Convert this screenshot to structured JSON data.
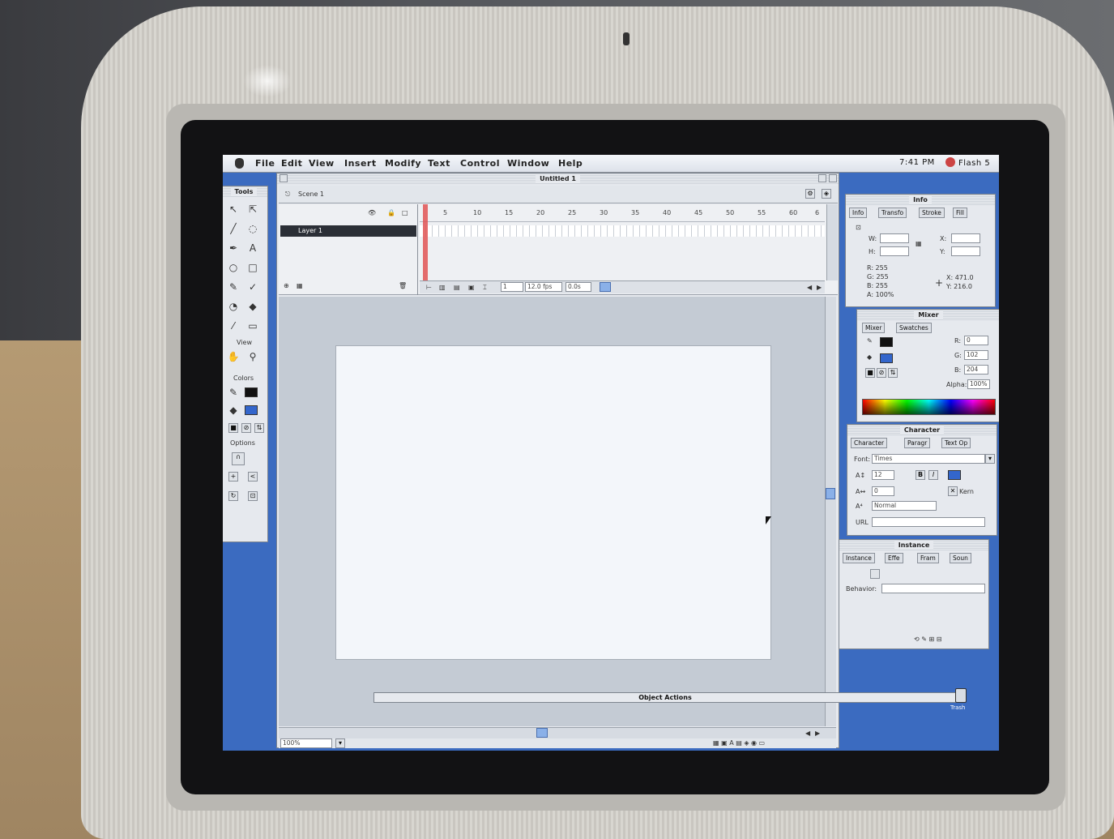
{
  "menubar": {
    "items": [
      "File",
      "Edit",
      "View",
      "Insert",
      "Modify",
      "Text",
      "Control",
      "Window",
      "Help"
    ],
    "clock": "7:41 PM",
    "app_name": "Flash 5"
  },
  "tools": {
    "title": "Tools",
    "view_label": "View",
    "colors_label": "Colors",
    "options_label": "Options",
    "items": [
      "arrow-icon",
      "subselect-icon",
      "line-icon",
      "lasso-icon",
      "pen-icon",
      "text-tool-icon",
      "oval-icon",
      "rectangle-icon",
      "pencil-icon",
      "brush-icon",
      "ink-bottle-icon",
      "paint-bucket-icon",
      "eyedropper-icon",
      "eraser-icon"
    ]
  },
  "document": {
    "title": "Untitled 1",
    "scene": "Scene 1",
    "layer": "Layer 1",
    "frame_numbers": [
      "5",
      "10",
      "15",
      "20",
      "25",
      "30",
      "35",
      "40",
      "45",
      "50",
      "55",
      "60",
      "6"
    ],
    "current_frame": "1",
    "fps": "12.0 fps",
    "elapsed": "0.0s",
    "zoom": "100%",
    "object_actions": "Object Actions"
  },
  "info_panel": {
    "title": "Info",
    "tabs": [
      "Info",
      "Transfo",
      "Stroke",
      "Fill"
    ],
    "w_label": "W:",
    "h_label": "H:",
    "x_label": "X:",
    "y_label": "Y:",
    "r": "R: 255",
    "g": "G: 255",
    "b": "B: 255",
    "a": "A: 100%",
    "cursor_x": "X: 471.0",
    "cursor_y": "Y: 216.0"
  },
  "mixer_panel": {
    "title": "Mixer",
    "tabs": [
      "Mixer",
      "Swatches"
    ],
    "r_label": "R:",
    "r": "0",
    "g_label": "G:",
    "g": "102",
    "b_label": "B:",
    "b": "204",
    "alpha_label": "Alpha:",
    "alpha": "100%"
  },
  "character_panel": {
    "title": "Character",
    "tabs": [
      "Character",
      "Paragr",
      "Text Op"
    ],
    "font_label": "Font:",
    "font": "Times",
    "size": "12",
    "tracking": "0",
    "bold": "B",
    "italic": "I",
    "kern": "Kern",
    "position": "Normal",
    "url_label": "URL"
  },
  "instance_panel": {
    "title": "Instance",
    "tabs": [
      "Instance",
      "Effe",
      "Fram",
      "Soun"
    ],
    "behavior_label": "Behavior:"
  },
  "desktop": {
    "trash_label": "Trash"
  },
  "colors": {
    "desktop": "#3b6bc0",
    "mixer_fill": "#3366cc"
  }
}
